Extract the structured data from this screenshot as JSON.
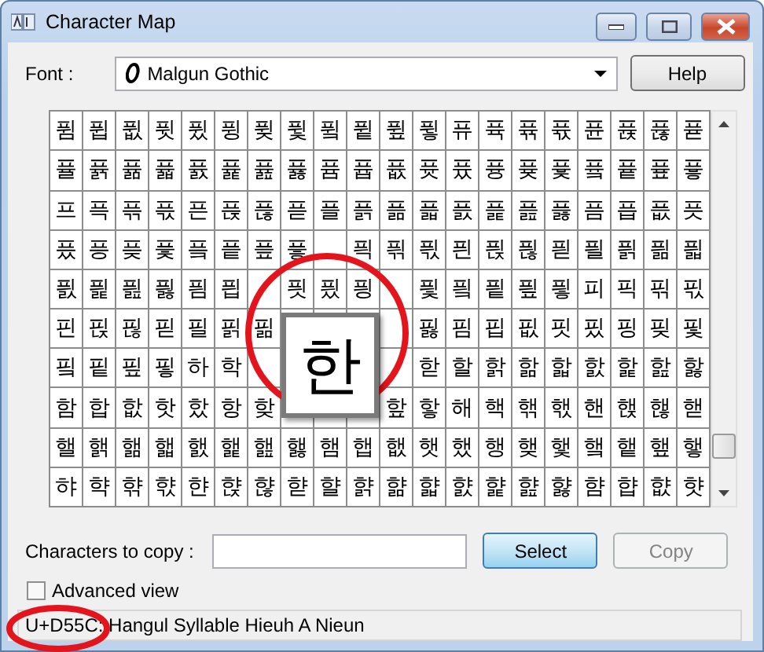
{
  "window": {
    "title": "Character Map"
  },
  "font": {
    "label": "Font :",
    "value": "Malgun Gothic"
  },
  "help_button": "Help",
  "grid": {
    "rows": [
      [
        "퓜",
        "퓝",
        "퓞",
        "퓟",
        "퓠",
        "퓡",
        "퓢",
        "퓣",
        "퓤",
        "퓥",
        "퓦",
        "퓧",
        "퓨",
        "퓩",
        "퓪",
        "퓫",
        "퓬",
        "퓭",
        "퓮",
        "퓯"
      ],
      [
        "퓰",
        "퓱",
        "퓲",
        "퓳",
        "퓴",
        "퓵",
        "퓶",
        "퓷",
        "퓸",
        "퓹",
        "퓺",
        "퓻",
        "퓼",
        "퓽",
        "퓾",
        "퓿",
        "픀",
        "픁",
        "픂",
        "픃"
      ],
      [
        "프",
        "픅",
        "픆",
        "픇",
        "픈",
        "픉",
        "픊",
        "픋",
        "플",
        "픍",
        "픎",
        "픏",
        "픐",
        "픑",
        "픒",
        "픓",
        "픔",
        "픕",
        "픖",
        "픗"
      ],
      [
        "픘",
        "픙",
        "픚",
        "픛",
        "픜",
        "픝",
        "픞",
        "픟",
        null,
        "픡",
        "픢",
        "픣",
        "픤",
        "픥",
        "픦",
        "픧",
        "픨",
        "픩",
        "픪",
        "픫"
      ],
      [
        "픬",
        "픭",
        "픮",
        "픯",
        "픰",
        "픱",
        null,
        "픳",
        "픴",
        "픵",
        null,
        "픷",
        "픸",
        "픹",
        "픺",
        "픻",
        "피",
        "픽",
        "픾",
        "픿"
      ],
      [
        "핀",
        "핁",
        "핂",
        "핃",
        "필",
        "핅",
        "핆",
        null,
        null,
        null,
        null,
        "핋",
        "핌",
        "핍",
        "핎",
        "핏",
        "핐",
        "핑",
        "핒",
        "핓"
      ],
      [
        "핔",
        "핕",
        "핖",
        "핗",
        "하",
        "학",
        null,
        null,
        null,
        null,
        null,
        "핟",
        "할",
        "핡",
        "핢",
        "핣",
        "핤",
        "핥",
        "핦",
        "핧"
      ],
      [
        "함",
        "합",
        "핪",
        "핫",
        "핬",
        "항",
        "핮",
        null,
        null,
        null,
        "핲",
        "핳",
        "해",
        "핵",
        "핶",
        "핷",
        "핸",
        "핹",
        "핺",
        "핻"
      ],
      [
        "핼",
        "핽",
        "핾",
        "핿",
        "햀",
        "햁",
        "햂",
        "햃",
        "햄",
        "햅",
        "햆",
        "햇",
        "했",
        "행",
        "햊",
        "햋",
        "햌",
        "햍",
        "햎",
        "햏"
      ],
      [
        "햐",
        "햑",
        "햒",
        "햓",
        "햔",
        "햕",
        "햖",
        "햗",
        "햘",
        "햙",
        "햚",
        "햛",
        "햜",
        "햝",
        "햞",
        "햟",
        "햠",
        "햡",
        "햢",
        "햣"
      ]
    ],
    "magnified": "한"
  },
  "copy": {
    "label": "Characters to copy :"
  },
  "select_button": "Select",
  "copy_button": {
    "label": "Copy",
    "disabled": true
  },
  "advanced_view": {
    "label": "Advanced view",
    "checked": false
  },
  "status_bar": "U+D55C: Hangul Syllable Hieuh A Nieun"
}
